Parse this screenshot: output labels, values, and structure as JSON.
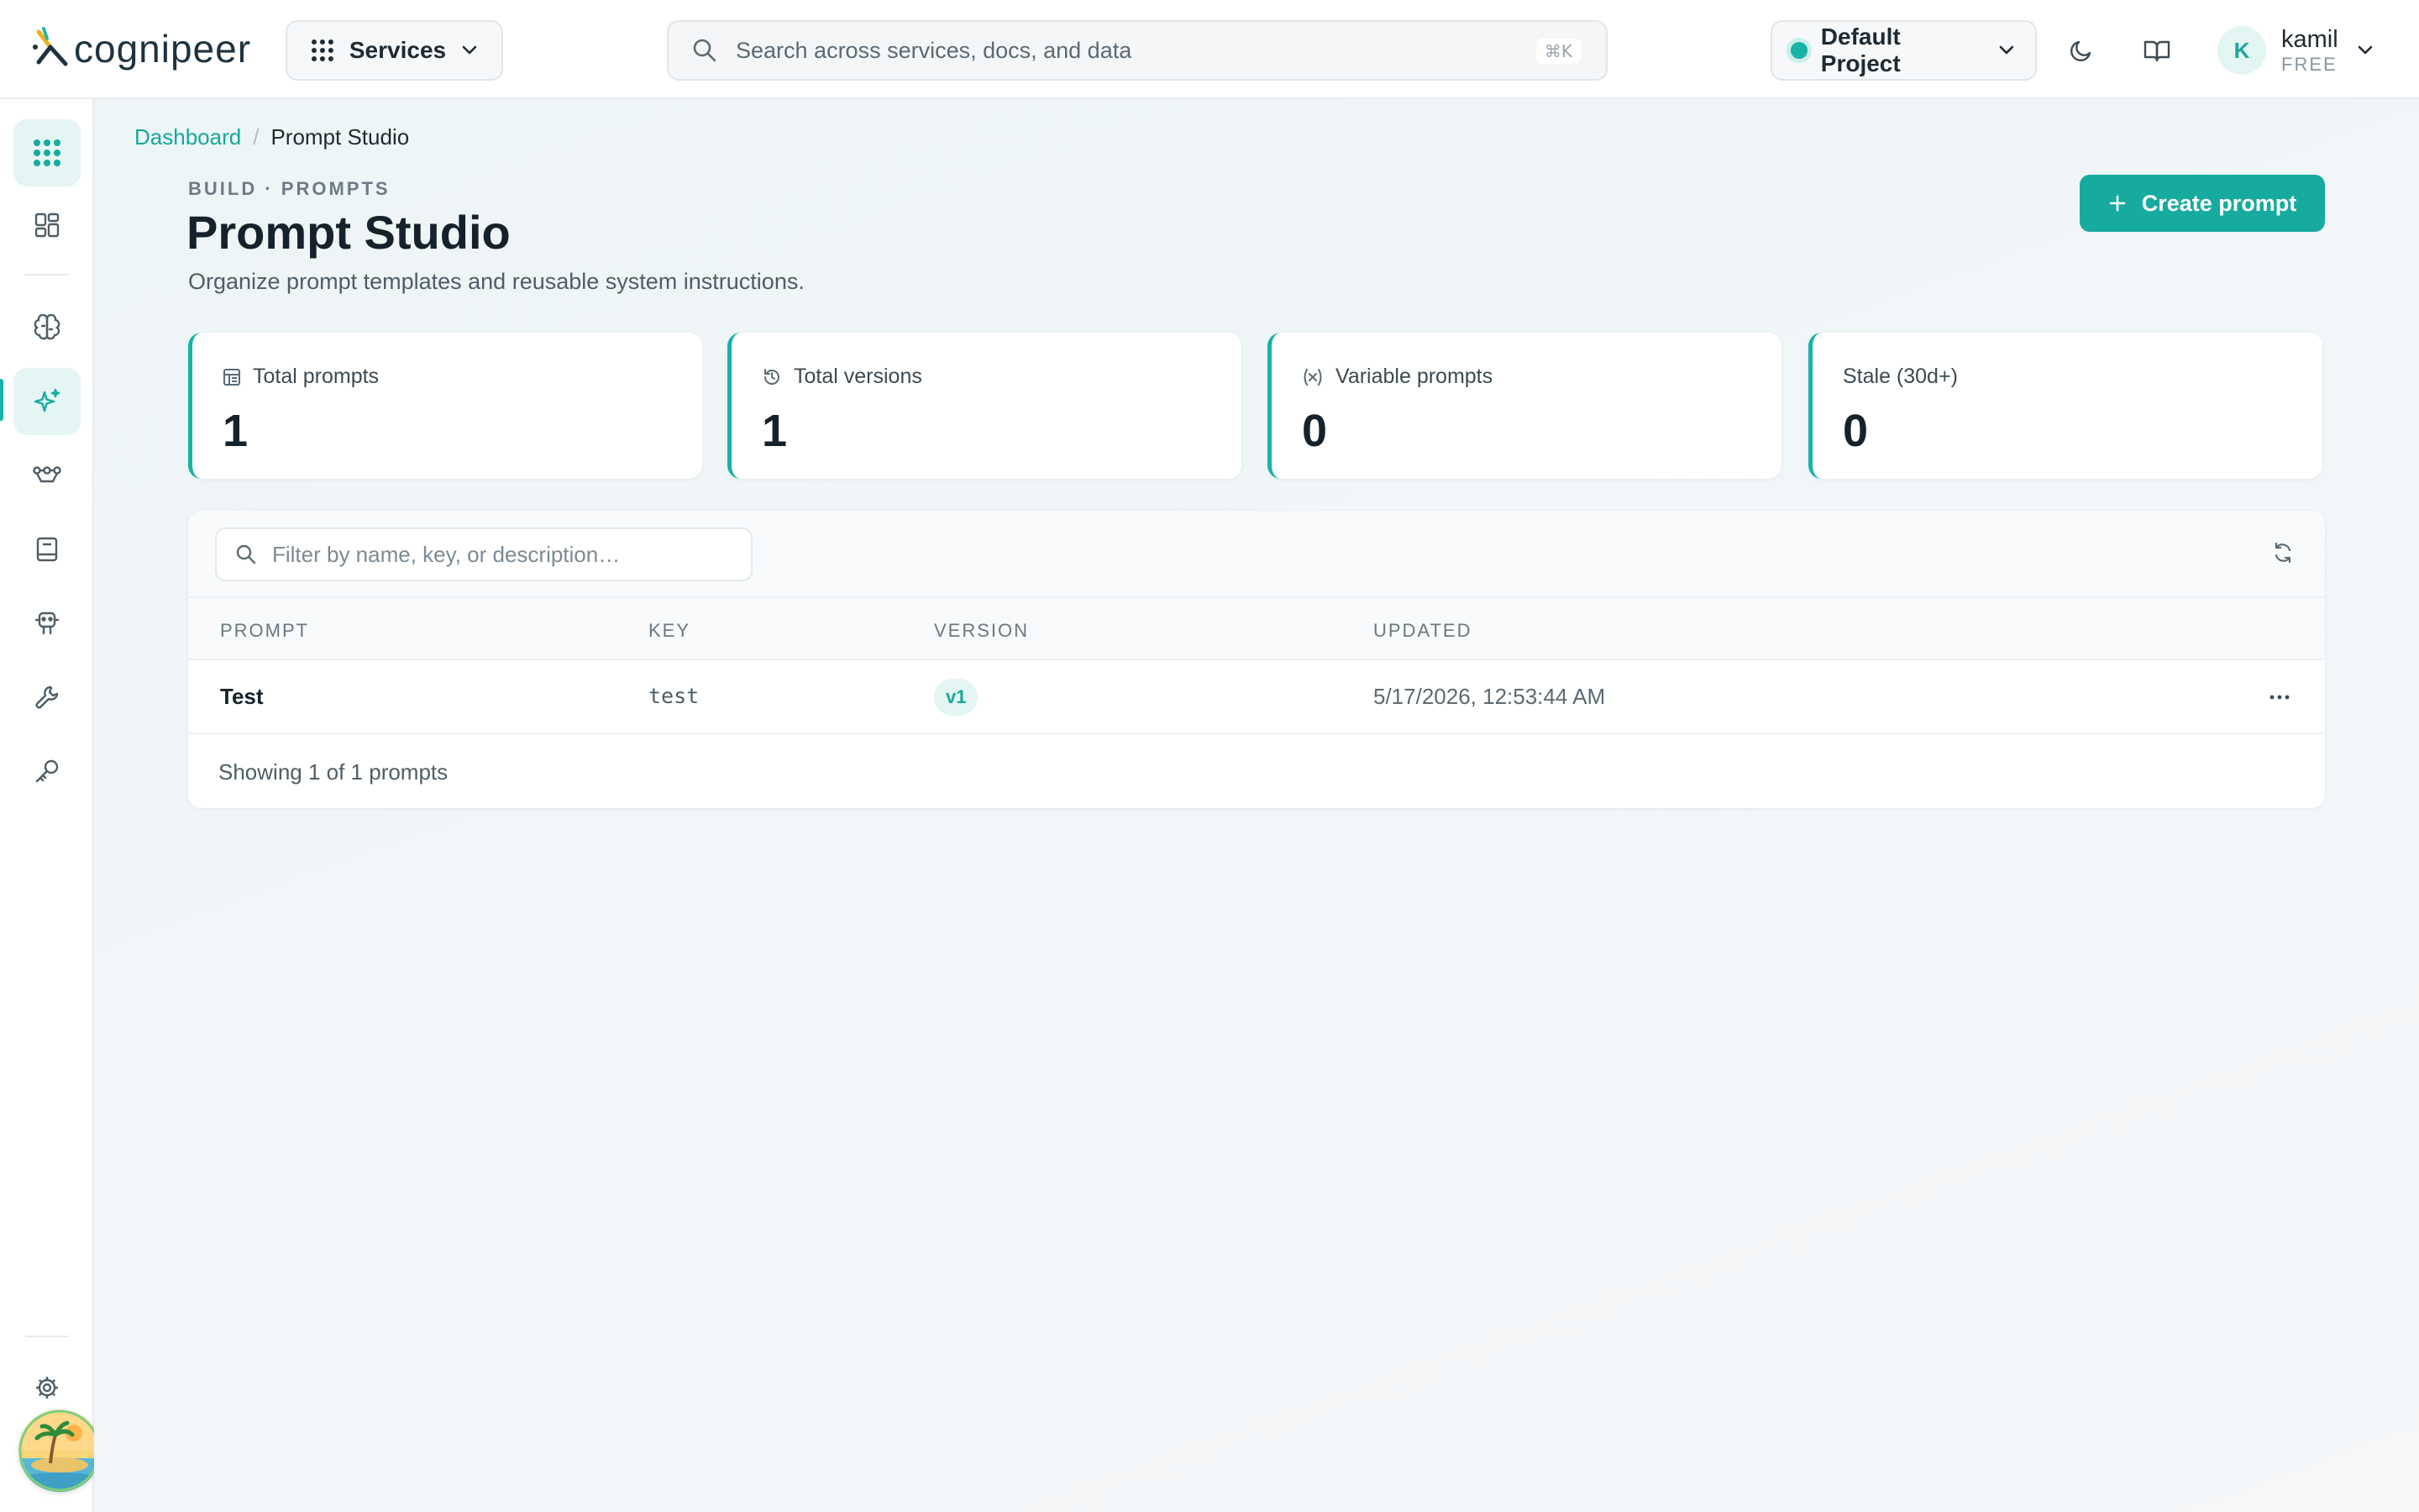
{
  "header": {
    "logo_text": "cognipeer",
    "services_label": "Services",
    "search_placeholder": "Search across services, docs, and data",
    "search_shortcut": "⌘K",
    "project_label": "Default Project",
    "user_initial": "K",
    "user_name": "kamil",
    "user_plan": "FREE"
  },
  "sidebar": {
    "items": [
      {
        "name": "services-grid",
        "active": true
      },
      {
        "name": "dashboard",
        "active": false
      },
      {
        "name": "models",
        "active": false
      },
      {
        "name": "prompt-studio",
        "active": true
      },
      {
        "name": "flows",
        "active": false
      },
      {
        "name": "knowledge",
        "active": false
      },
      {
        "name": "agents",
        "active": false
      },
      {
        "name": "tools",
        "active": false
      },
      {
        "name": "api-keys",
        "active": false
      },
      {
        "name": "settings",
        "active": false
      }
    ]
  },
  "breadcrumb": {
    "root": "Dashboard",
    "separator": "/",
    "current": "Prompt Studio"
  },
  "page": {
    "eyebrow": "BUILD · PROMPTS",
    "title": "Prompt Studio",
    "subtitle": "Organize prompt templates and reusable system instructions.",
    "create_label": "Create prompt"
  },
  "stats": [
    {
      "label": "Total prompts",
      "value": "1",
      "icon": "list-icon"
    },
    {
      "label": "Total versions",
      "value": "1",
      "icon": "history-icon"
    },
    {
      "label": "Variable prompts",
      "value": "0",
      "icon": "variable-icon"
    },
    {
      "label": "Stale (30d+)",
      "value": "0",
      "icon": ""
    }
  ],
  "table": {
    "filter_placeholder": "Filter by name, key, or description…",
    "columns": [
      "PROMPT",
      "KEY",
      "VERSION",
      "UPDATED"
    ],
    "rows": [
      {
        "prompt": "Test",
        "key": "test",
        "version": "v1",
        "updated": "5/17/2026, 12:53:44 AM"
      }
    ],
    "footer": "Showing 1 of 1 prompts"
  },
  "colors": {
    "accent": "#17ab9f",
    "accent_light": "#e3f5f2",
    "text": "#1f2a33"
  }
}
